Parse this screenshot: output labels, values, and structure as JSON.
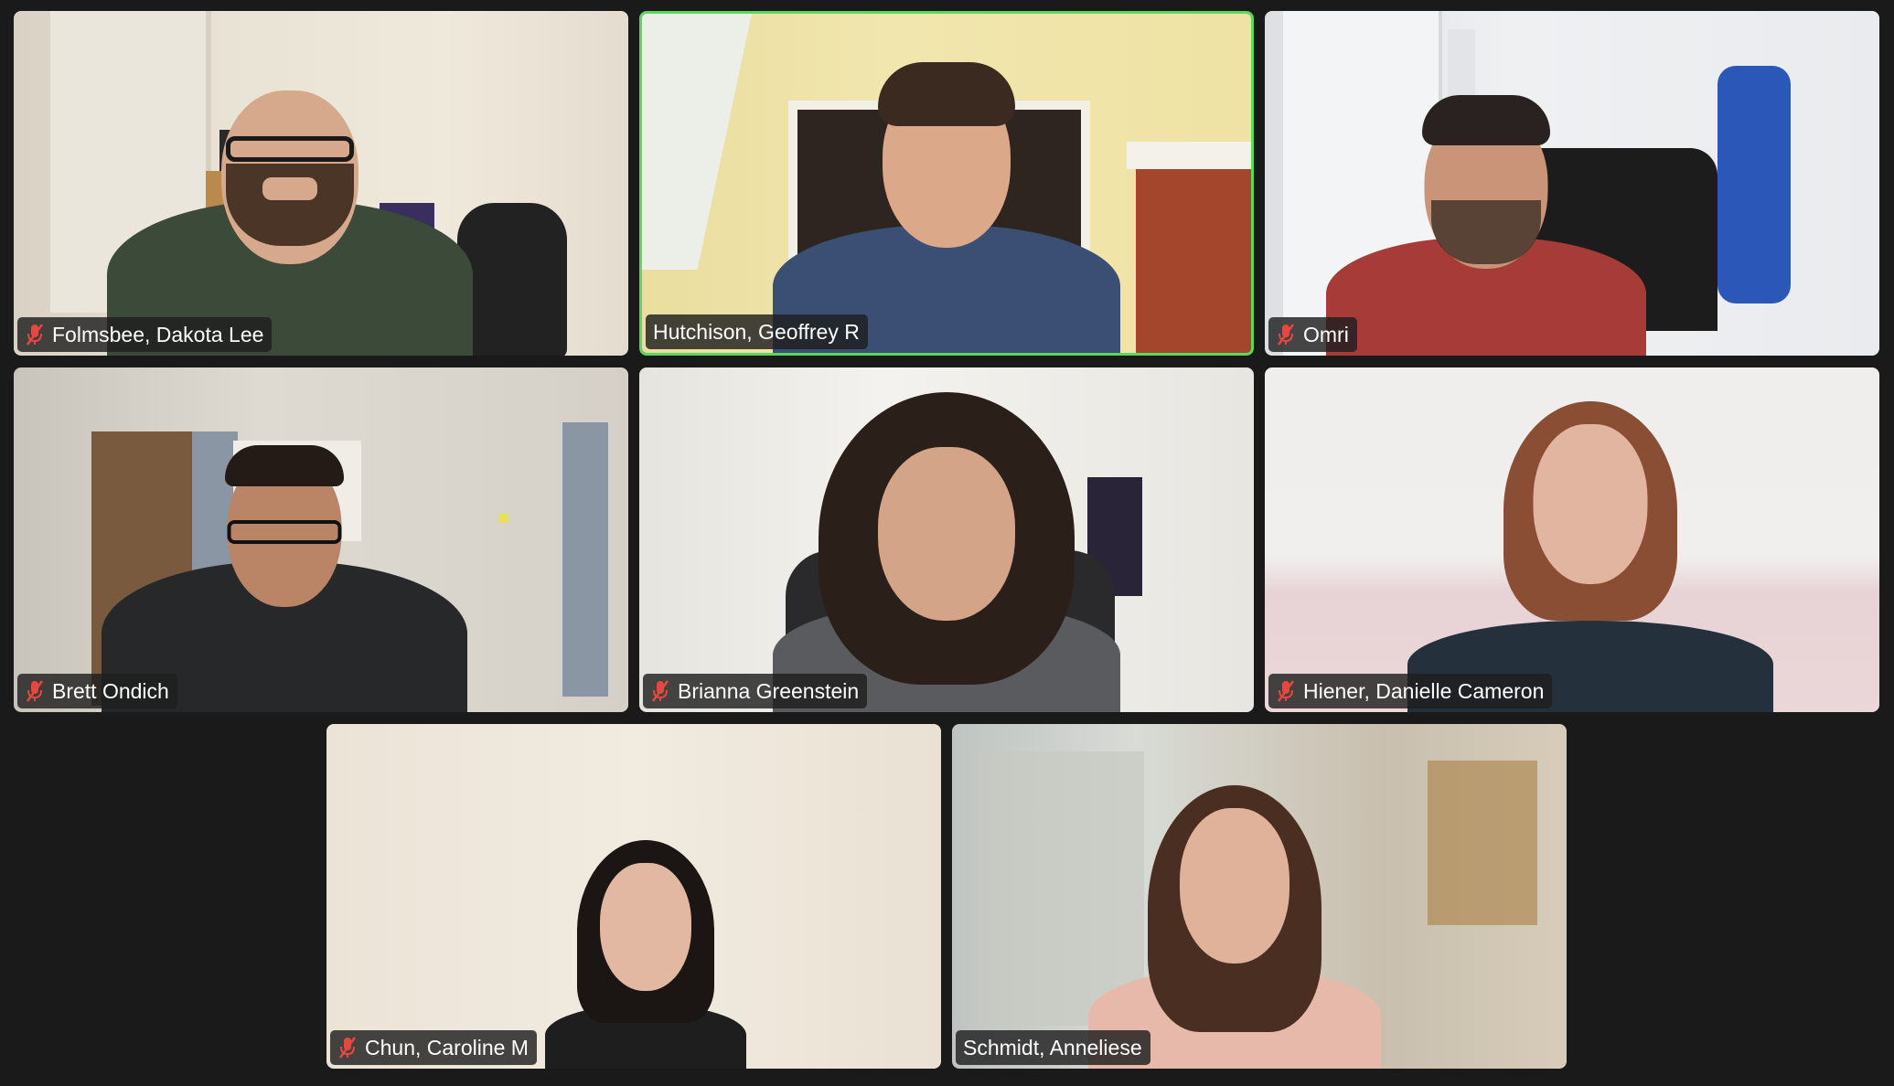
{
  "app": {
    "view": "gallery",
    "active_speaker_color": "#5cd65c",
    "muted_icon_color": "#e5483f",
    "background_color": "#1a1a1a"
  },
  "participants": [
    {
      "name": "Folmsbee, Dakota Lee",
      "muted": true,
      "active_speaker": false
    },
    {
      "name": "Hutchison, Geoffrey R",
      "muted": false,
      "active_speaker": true
    },
    {
      "name": "Omri",
      "muted": true,
      "active_speaker": false
    },
    {
      "name": "Brett Ondich",
      "muted": true,
      "active_speaker": false
    },
    {
      "name": "Brianna Greenstein",
      "muted": true,
      "active_speaker": false
    },
    {
      "name": "Hiener, Danielle Cameron",
      "muted": true,
      "active_speaker": false
    },
    {
      "name": "Chun, Caroline M",
      "muted": true,
      "active_speaker": false
    },
    {
      "name": "Schmidt, Anneliese",
      "muted": false,
      "active_speaker": false
    }
  ]
}
